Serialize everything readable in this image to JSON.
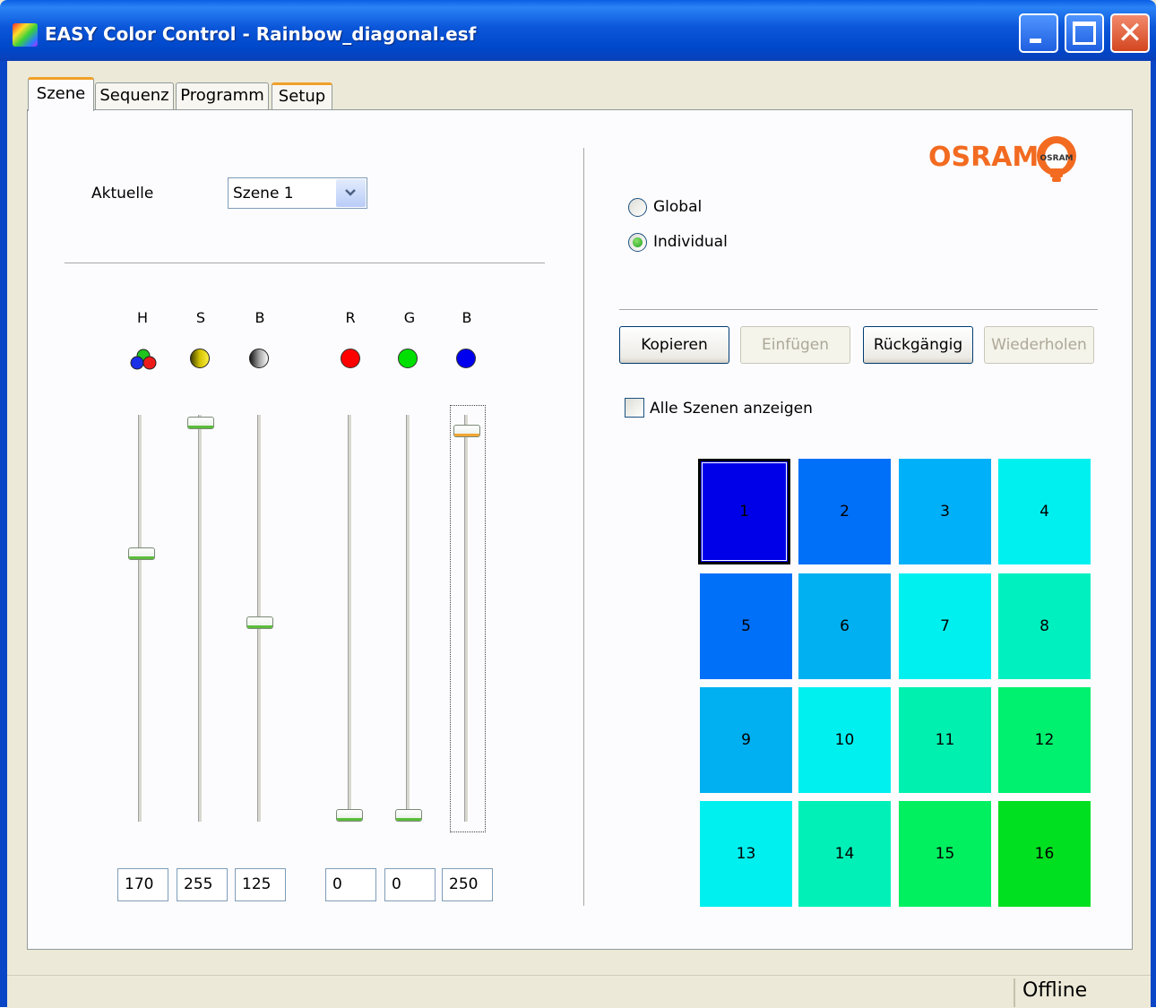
{
  "window": {
    "title": "EASY Color Control - Rainbow_diagonal.esf"
  },
  "tabs": [
    {
      "label": "Szene",
      "active": true
    },
    {
      "label": "Sequenz",
      "active": false
    },
    {
      "label": "Programm",
      "active": false
    },
    {
      "label": "Setup",
      "active": false
    }
  ],
  "scene_panel": {
    "current_label": "Aktuelle",
    "current_value": "Szene 1"
  },
  "channels": [
    {
      "label": "H",
      "icon": "hue-icon",
      "value": "170"
    },
    {
      "label": "S",
      "icon": "saturation-icon",
      "value": "255"
    },
    {
      "label": "B",
      "icon": "brightness-icon",
      "value": "125"
    },
    {
      "label": "R",
      "icon": "red-icon",
      "value": "0",
      "color": "#ff0000"
    },
    {
      "label": "G",
      "icon": "green-icon",
      "value": "0",
      "color": "#00e000"
    },
    {
      "label": "B",
      "icon": "blue-icon",
      "value": "250",
      "color": "#0000ee"
    }
  ],
  "mode": {
    "global_label": "Global",
    "individual_label": "Individual",
    "selected": "Individual"
  },
  "buttons": {
    "copy": "Kopieren",
    "paste": "Einfügen",
    "undo": "Rückgängig",
    "redo": "Wiederholen"
  },
  "show_all_label": "Alle Szenen anzeigen",
  "brand": {
    "logo_text": "OSRAM",
    "color": "#f26b21"
  },
  "scenes": [
    {
      "label": "1",
      "color": "#0000e8"
    },
    {
      "label": "2",
      "color": "#0070f8"
    },
    {
      "label": "3",
      "color": "#00b0f8"
    },
    {
      "label": "4",
      "color": "#00f0f0"
    },
    {
      "label": "5",
      "color": "#0070f8"
    },
    {
      "label": "6",
      "color": "#00b0f0"
    },
    {
      "label": "7",
      "color": "#00f0f0"
    },
    {
      "label": "8",
      "color": "#00f0c0"
    },
    {
      "label": "9",
      "color": "#00b0f0"
    },
    {
      "label": "10",
      "color": "#00f0f0"
    },
    {
      "label": "11",
      "color": "#00f0b0"
    },
    {
      "label": "12",
      "color": "#00f070"
    },
    {
      "label": "13",
      "color": "#00f0f0"
    },
    {
      "label": "14",
      "color": "#00f0b8"
    },
    {
      "label": "15",
      "color": "#00f060"
    },
    {
      "label": "16",
      "color": "#00e020"
    }
  ],
  "status": {
    "connection": "Offline"
  }
}
